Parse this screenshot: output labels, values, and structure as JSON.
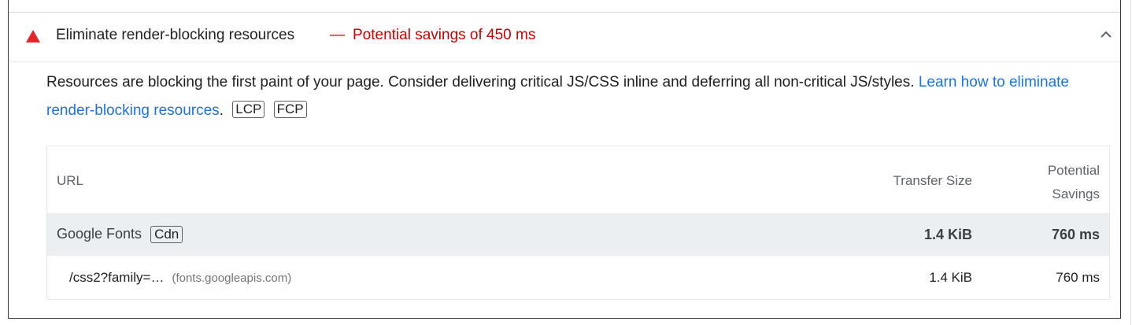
{
  "audit": {
    "title": "Eliminate render-blocking resources",
    "dash": "—",
    "savings_text": "Potential savings of 450 ms",
    "status": "fail",
    "fail_color": "#e8242b",
    "icons": {
      "status": "triangle-warning-icon",
      "toggle": "chevron-up-icon"
    },
    "description": {
      "text": "Resources are blocking the first paint of your page. Consider delivering critical JS/CSS inline and deferring all non-critical JS/styles.",
      "link_text": "Learn how to eliminate render-blocking resources",
      "after_link": ".",
      "badges": [
        "LCP",
        "FCP"
      ]
    }
  },
  "table": {
    "headers": {
      "url": "URL",
      "transfer_size": "Transfer Size",
      "savings_line1": "Potential",
      "savings_line2": "Savings"
    },
    "group": {
      "name": "Google Fonts",
      "badge": "Cdn",
      "transfer_size": "1.4 KiB",
      "savings": "760 ms"
    },
    "items": [
      {
        "url": "/css2?family=…",
        "host": "(fonts.googleapis.com)",
        "transfer_size": "1.4 KiB",
        "savings": "760 ms"
      }
    ]
  }
}
